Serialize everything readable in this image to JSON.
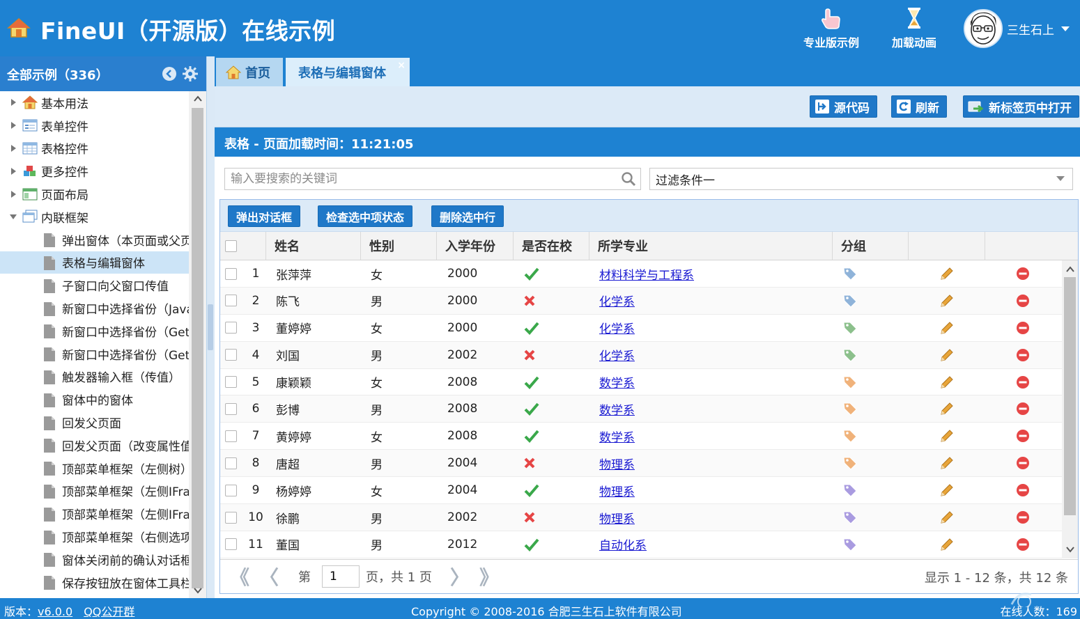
{
  "header": {
    "title": "FineUI（开源版）在线示例",
    "buttons": [
      {
        "label": "专业版示例",
        "icon": "hand-pointer-icon"
      },
      {
        "label": "加载动画",
        "icon": "hourglass-icon"
      }
    ],
    "user": {
      "name": "三生石上",
      "icon": "avatar"
    }
  },
  "sidebar": {
    "title": "全部示例（336）",
    "tree": [
      {
        "label": "基本用法",
        "type": "folder",
        "expanded": false,
        "icon": "house-icon"
      },
      {
        "label": "表单控件",
        "type": "folder",
        "expanded": false,
        "icon": "form-icon"
      },
      {
        "label": "表格控件",
        "type": "folder",
        "expanded": false,
        "icon": "table-icon"
      },
      {
        "label": "更多控件",
        "type": "folder",
        "expanded": false,
        "icon": "blocks-icon"
      },
      {
        "label": "页面布局",
        "type": "folder",
        "expanded": false,
        "icon": "layout-icon"
      },
      {
        "label": "内联框架",
        "type": "folder",
        "expanded": true,
        "icon": "window-icon"
      },
      {
        "label": "弹出窗体（本页面或父页面）",
        "type": "leaf"
      },
      {
        "label": "表格与编辑窗体",
        "type": "leaf",
        "selected": true
      },
      {
        "label": "子窗口向父窗口传值",
        "type": "leaf"
      },
      {
        "label": "新窗口中选择省份（JavaScript）",
        "type": "leaf"
      },
      {
        "label": "新窗口中选择省份（GetSaveStateReference）",
        "type": "leaf"
      },
      {
        "label": "新窗口中选择省份（GetSelectedRowReference）",
        "type": "leaf"
      },
      {
        "label": "触发器输入框（传值）",
        "type": "leaf"
      },
      {
        "label": "窗体中的窗体",
        "type": "leaf"
      },
      {
        "label": "回发父页面",
        "type": "leaf"
      },
      {
        "label": "回发父页面（改变属性值）",
        "type": "leaf"
      },
      {
        "label": "顶部菜单框架（左侧树）",
        "type": "leaf"
      },
      {
        "label": "顶部菜单框架（左侧IFrame）",
        "type": "leaf"
      },
      {
        "label": "顶部菜单框架（左侧IFrame，右侧选项卡）",
        "type": "leaf"
      },
      {
        "label": "顶部菜单框架（右侧选项卡）",
        "type": "leaf"
      },
      {
        "label": "窗体关闭前的确认对话框",
        "type": "leaf"
      },
      {
        "label": "保存按钮放在窗体工具栏中",
        "type": "leaf"
      }
    ]
  },
  "tabs": [
    {
      "label": "首页",
      "icon": "house-icon",
      "active": false
    },
    {
      "label": "表格与编辑窗体",
      "active": true,
      "close": "×"
    }
  ],
  "toolbar": {
    "source_label": "源代码",
    "refresh_label": "刷新",
    "newtab_label": "新标签页中打开"
  },
  "panel": {
    "title": "表格 - 页面加载时间：11:21:05"
  },
  "search": {
    "placeholder": "输入要搜索的关键词",
    "value": ""
  },
  "filter": {
    "value": "过滤条件一"
  },
  "grid": {
    "buttons": [
      "弹出对话框",
      "检查选中项状态",
      "删除选中行"
    ],
    "columns": [
      "姓名",
      "性别",
      "入学年份",
      "是否在校",
      "所学专业",
      "分组",
      "",
      ""
    ],
    "rows": [
      {
        "no": "1",
        "name": "张萍萍",
        "gender": "女",
        "year": "2000",
        "inschool": true,
        "major": "材料科学与工程系",
        "tag": "#8fb3d9"
      },
      {
        "no": "2",
        "name": "陈飞",
        "gender": "男",
        "year": "2000",
        "inschool": false,
        "major": "化学系",
        "tag": "#8fb3d9"
      },
      {
        "no": "3",
        "name": "董婷婷",
        "gender": "女",
        "year": "2000",
        "inschool": true,
        "major": "化学系",
        "tag": "#8cc08c"
      },
      {
        "no": "4",
        "name": "刘国",
        "gender": "男",
        "year": "2002",
        "inschool": false,
        "major": "化学系",
        "tag": "#8cc08c"
      },
      {
        "no": "5",
        "name": "康颖颖",
        "gender": "女",
        "year": "2008",
        "inschool": true,
        "major": "数学系",
        "tag": "#f0b27a"
      },
      {
        "no": "6",
        "name": "彭博",
        "gender": "男",
        "year": "2008",
        "inschool": true,
        "major": "数学系",
        "tag": "#f0b27a"
      },
      {
        "no": "7",
        "name": "黄婷婷",
        "gender": "女",
        "year": "2008",
        "inschool": true,
        "major": "数学系",
        "tag": "#f0b27a"
      },
      {
        "no": "8",
        "name": "唐超",
        "gender": "男",
        "year": "2004",
        "inschool": false,
        "major": "物理系",
        "tag": "#f0b27a"
      },
      {
        "no": "9",
        "name": "杨婷婷",
        "gender": "女",
        "year": "2004",
        "inschool": true,
        "major": "物理系",
        "tag": "#a99be0"
      },
      {
        "no": "10",
        "name": "徐鹏",
        "gender": "男",
        "year": "2002",
        "inschool": false,
        "major": "物理系",
        "tag": "#a99be0"
      },
      {
        "no": "11",
        "name": "董国",
        "gender": "男",
        "year": "2012",
        "inschool": true,
        "major": "自动化系",
        "tag": "#a99be0"
      }
    ]
  },
  "pager": {
    "first": "《",
    "prev": "〈",
    "prefix": "第",
    "page": "1",
    "suffix": "页，共 1 页",
    "next": "〉",
    "last": "》",
    "info": "显示 1 - 12 条，共 12 条"
  },
  "footer": {
    "version_label": "版本：",
    "version": "v6.0.0",
    "qq": "QQ公开群",
    "copyright": "Copyright © 2008-2016 合肥三生石上软件有限公司",
    "online_label": "在线人数：",
    "online": "169"
  },
  "colors": {
    "primary": "#1e82d2",
    "check": "#3aa84a",
    "cross": "#e64545",
    "delete": "#e64545",
    "edit": "#e8a53a"
  }
}
